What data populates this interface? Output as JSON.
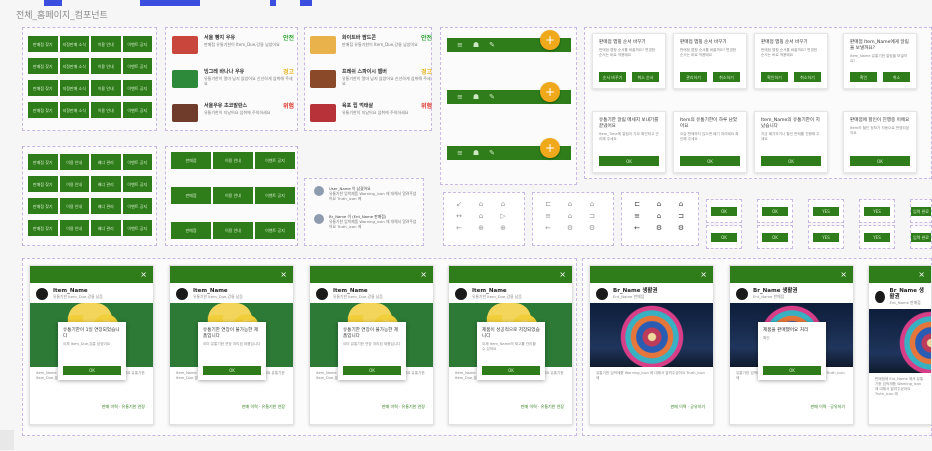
{
  "page": {
    "title": "전체_홈페이지_컴포넌트",
    "colors": {
      "primary": "#2e7d1a",
      "accent": "#f0a91b",
      "danger": "#e0322a",
      "safe": "#2fa334",
      "caution": "#e8b51e",
      "frame": "#c9b8e6"
    }
  },
  "nav_a": [
    [
      "판매점 찾기",
      "지정판매 소식",
      "이용 안내",
      "이벤트 공지"
    ],
    [
      "판매점 찾기",
      "지정판매 소식",
      "이용 안내",
      "이벤트 공지"
    ],
    [
      "판매점 찾기",
      "지정판매 소식",
      "이용 안내",
      "이벤트 공지"
    ],
    [
      "판매점 찾기",
      "지정판매 소식",
      "이용 안내",
      "이벤트 공지"
    ]
  ],
  "nav_b": [
    [
      "판매점 찾기",
      "이용 안내",
      "배너 관리",
      "이벤트 공지"
    ],
    [
      "판매점 찾기",
      "이용 안내",
      "배너 관리",
      "이벤트 공지"
    ],
    [
      "판매점 찾기",
      "이용 안내",
      "배너 관리",
      "이벤트 공지"
    ],
    [
      "판매점 찾기",
      "이용 안내",
      "배너 관리",
      "이벤트 공지"
    ]
  ],
  "nav_c": [
    [
      "판매점",
      "이용 안내",
      "이벤트 공지"
    ],
    [
      "판매점",
      "이용 안내",
      "이벤트 공지"
    ],
    [
      "판매점",
      "이용 안내",
      "이벤트 공지"
    ]
  ],
  "stock_list_a": [
    {
      "title": "서울 빵지 우유",
      "tag": "안전",
      "tag_color": "#2fa334",
      "desc": "판매점 유통기한이 Item_Due,강릉 남았어요",
      "thumb": "#c9463d"
    },
    {
      "title": "빙그레 바나나 우유",
      "tag": "경고",
      "tag_color": "#e8b51e",
      "desc": "유통기한이 얼마 남지 않았어요 신선하게 섭취해 주세요",
      "thumb": "#2d8a3a"
    },
    {
      "title": "서울우유 초코발란스",
      "tag": "위험",
      "tag_color": "#e0322a",
      "desc": "유통기한이 지났어요 섭취에 주의하세요",
      "thumb": "#6f3b2a"
    }
  ],
  "stock_list_b": [
    {
      "title": "화이트바 팜드콘",
      "tag": "안전",
      "tag_color": "#2fa334",
      "desc": "판매점 유통기한이 Item_Due,강릉 남았어요",
      "thumb": "#e9b24a"
    },
    {
      "title": "프레쉬 스파이시 햄버",
      "tag": "경고",
      "tag_color": "#e8b51e",
      "desc": "유통기한이 얼마 남지 않았어요 신선하게 섭취해 주세요",
      "thumb": "#8a4a2a"
    },
    {
      "title": "육포 립 먹태살",
      "tag": "위험",
      "tag_color": "#e0322a",
      "desc": "유통기한이 지났어요 섭취에 주의하세요",
      "thumb": "#b8323a"
    }
  ],
  "dialogs_two_btn": [
    {
      "title": "판매점 맵핑 순서 바꾸기",
      "body": "판매점 맵핑 순서를 바꿀까요? 변경한 순서는 바로 적용돼요",
      "left": "순서 바꾸기",
      "right": "취소 순서"
    },
    {
      "title": "판매점 맵핑 순서 바꾸기",
      "body": "판매점 맵핑 순서를 바꿀까요? 변경한 순서는 바로 적용돼요",
      "left": "관리하기",
      "right": "취소하기"
    },
    {
      "title": "판매점 맵핑 순서 바꾸기",
      "body": "판매점 맵핑 순서를 바꿀까요? 변경한 순서는 바로 적용돼요",
      "left": "확인하기",
      "right": "취소하기"
    },
    {
      "title": "판매점 Item_Name에게 알림을 보낼까요?",
      "body": "Item_Name 유통기한 알림을 보낼까요?",
      "left": "확인",
      "right": "취소"
    }
  ],
  "dialogs_one_btn": [
    {
      "title": "유통기한 알림 메세지 보내기를 끝냈어요",
      "body": "Item_Time에 알림이 가요 확인하고 관리해 주세요",
      "btn": "OK"
    },
    {
      "title": "Item의 유통기한이 하루 남았어요",
      "body": "오늘 판매하지 않으면 폐기 처리돼요 확인해 주세요",
      "btn": "OK"
    },
    {
      "title": "Item_Name의 유통기한이 지났습니다",
      "body": "지금 폐기하거나 할인 판매를 진행해 주세요",
      "btn": "OK"
    },
    {
      "title": "판매점에 할인이 진행중 이에요",
      "body": "Item의 할인 정보가 자동으로 반영되었어요",
      "btn": "OK"
    }
  ],
  "toolbar_icons": [
    "≡",
    "☗",
    "✎"
  ],
  "fab_symbol": "+",
  "comments": [
    {
      "name": "User_Name 이 남겼어요",
      "text": "유통기한 임박제품 Warning_icon 에 대해서 알려주셨어요 Truth_icon 에"
    },
    {
      "name": "Br_Name 이 (Ent_Name 판매점)",
      "text": "유통기한 임박제품 Warning_icon 에 대해서 알려주셨어요 Truth_icon 에"
    }
  ],
  "icon_grid_light": [
    "↙",
    "⌂",
    "⌂",
    "↔",
    "⌂",
    "▷",
    "←",
    "⊕",
    "⊕"
  ],
  "icon_grid_mid": [
    "⊏",
    "⌂",
    "⌂",
    "≡",
    "⌂",
    "⊐",
    "←",
    "⚙",
    "⚙"
  ],
  "icon_grid_dark": [
    "⊏",
    "⌂",
    "⌂",
    "≡",
    "⌂",
    "⊐",
    "←",
    "⚙",
    "⚙"
  ],
  "chips": [
    "OK",
    "OK",
    "YES",
    "YES",
    "입력 완료",
    "입력 완료"
  ],
  "posts": [
    {
      "name": "Item_Name",
      "sub": "유통기한 Item_Due,강릉 남음",
      "image": "milk",
      "year": "19 74",
      "modal_title": "유통기한이 1일 연장되었습니다",
      "modal_body": "이제 Item_Due,강릉 남았어요",
      "modal_btn": "OK",
      "text": "Item_Name 의 유통기한 Item_Due,강릉 알림을 알려드려요 유통기한 Item_Due,강릉 남았어요 지금 확인하세요",
      "links": "판매 이력 · 유통기한 연장"
    },
    {
      "name": "Item_Name",
      "sub": "유통기한 Item_Due,강릉 남음",
      "image": "milk",
      "year": "19 74",
      "modal_title": "유통기한 연장이 불가능한 제품입니다",
      "modal_body": "이미 유통기한 연장 처리된 제품입니다",
      "modal_btn": "OK",
      "text": "Item_Name 의 유통기한 Item_Due,강릉 알림을 알려드려요 유통기한 Item_Due,강릉 남았어요 지금 확인하세요",
      "links": "판매 이력 · 유통기한 연장"
    },
    {
      "name": "Item_Name",
      "sub": "유통기한 Item_Due,강릉 남음",
      "image": "milk",
      "year": "19 74",
      "modal_title": "유통기한 연장이 불가능한 제품입니다",
      "modal_body": "이미 유통기한 연장 처리된 제품입니다",
      "modal_btn": "OK",
      "text": "Item_Name 의 유통기한 Item_Due,강릉 알림을 알려드려요 유통기한 Item_Due,강릉 남았어요 지금 확인하세요",
      "links": "판매 이력 · 유통기한 연장"
    },
    {
      "name": "Item_Name",
      "sub": "유통기한 Item_Due,강릉 남음",
      "image": "milk",
      "year": "19 74",
      "modal_title": "제품이 성공적으로 저장되었습니다",
      "modal_body": "이제 Item_Name의 재고를 관리할 수 있어요",
      "modal_btn": "OK",
      "text": "Item_Name 의 유통기한 Item_Due,강릉 알림을 알려드려요 유통기한 Item_Due,강릉 남았어요 지금 확인하세요",
      "links": "판매 이력 · 유통기한 연장"
    },
    {
      "name": "Br_Name 생활권",
      "sub": "Ent_Name 판매점",
      "image": "night",
      "year": "",
      "modal_title": "",
      "modal_body": "",
      "modal_btn": "",
      "text": "유통기한 임박제품 Warning_icon 에 대해서 알려주셨어요 Truth_icon 에",
      "links": "판매 이력 · 공유하기"
    },
    {
      "name": "Br_Name 생활권",
      "sub": "Ent_Name 판매점",
      "image": "night",
      "year": "",
      "modal_title": "제품을 판매했어요 처리",
      "modal_body": "확인",
      "modal_btn": "OK",
      "text": "유통기한 임박제품 Warning_icon 에 대해서 알려주셨어요 Truth_icon 에",
      "links": "판매 이력 · 공유하기"
    },
    {
      "name": "Br_Name 생활권",
      "sub": "Ent_Name 판매점",
      "image": "night",
      "year": "",
      "modal_title": "",
      "modal_body": "",
      "modal_btn": "",
      "text": "판매점에 Ent_Name 에서 유통기한 임박제품 Warning_icon 에 대해서 알려주셨어요 Truth_icon 에",
      "links": ""
    }
  ],
  "close_glyph": "×"
}
